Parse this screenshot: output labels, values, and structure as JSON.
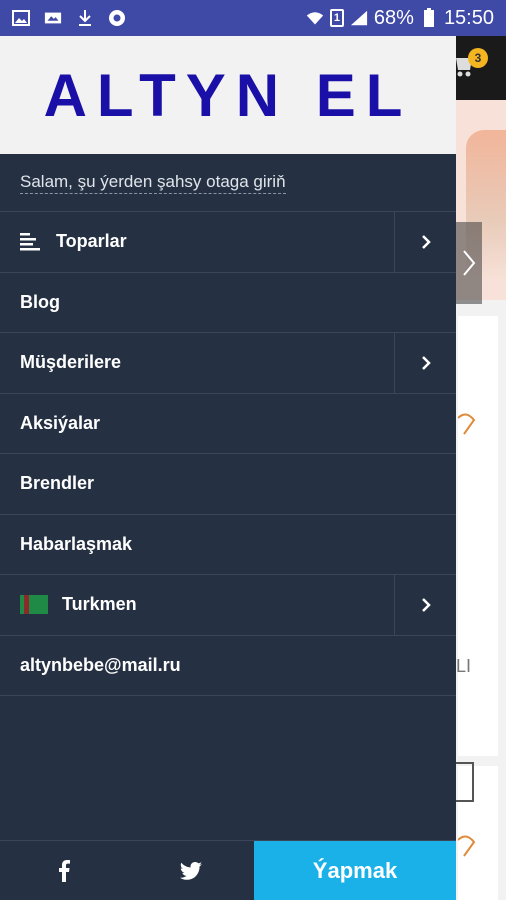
{
  "status_bar": {
    "battery": "68%",
    "time": "15:50",
    "sim": "1"
  },
  "background": {
    "cart_badge": "3",
    "partial_text": "LI"
  },
  "drawer": {
    "logo": "ALTYN EL",
    "greeting": "Salam, şu ýerden şahsy otaga giriň",
    "menu": [
      {
        "label": "Toparlar",
        "has_submenu": true,
        "icon": "list-icon"
      },
      {
        "label": "Blog",
        "has_submenu": false
      },
      {
        "label": "Müşderilere",
        "has_submenu": true
      },
      {
        "label": "Aksiýalar",
        "has_submenu": false
      },
      {
        "label": "Brendler",
        "has_submenu": false
      },
      {
        "label": "Habarlaşmak",
        "has_submenu": false
      },
      {
        "label": "Turkmen",
        "has_submenu": true,
        "icon": "turkmenistan-flag-icon"
      },
      {
        "label": "altynbebe@mail.ru",
        "has_submenu": false
      }
    ],
    "bottom": {
      "facebook": "facebook-icon",
      "twitter": "twitter-icon",
      "action_label": "Ýapmak"
    }
  },
  "colors": {
    "status_bar": "#3f49a6",
    "drawer_bg": "#253142",
    "logo": "#1a10a8",
    "action_button": "#1ab0e8",
    "badge": "#f4b620"
  }
}
